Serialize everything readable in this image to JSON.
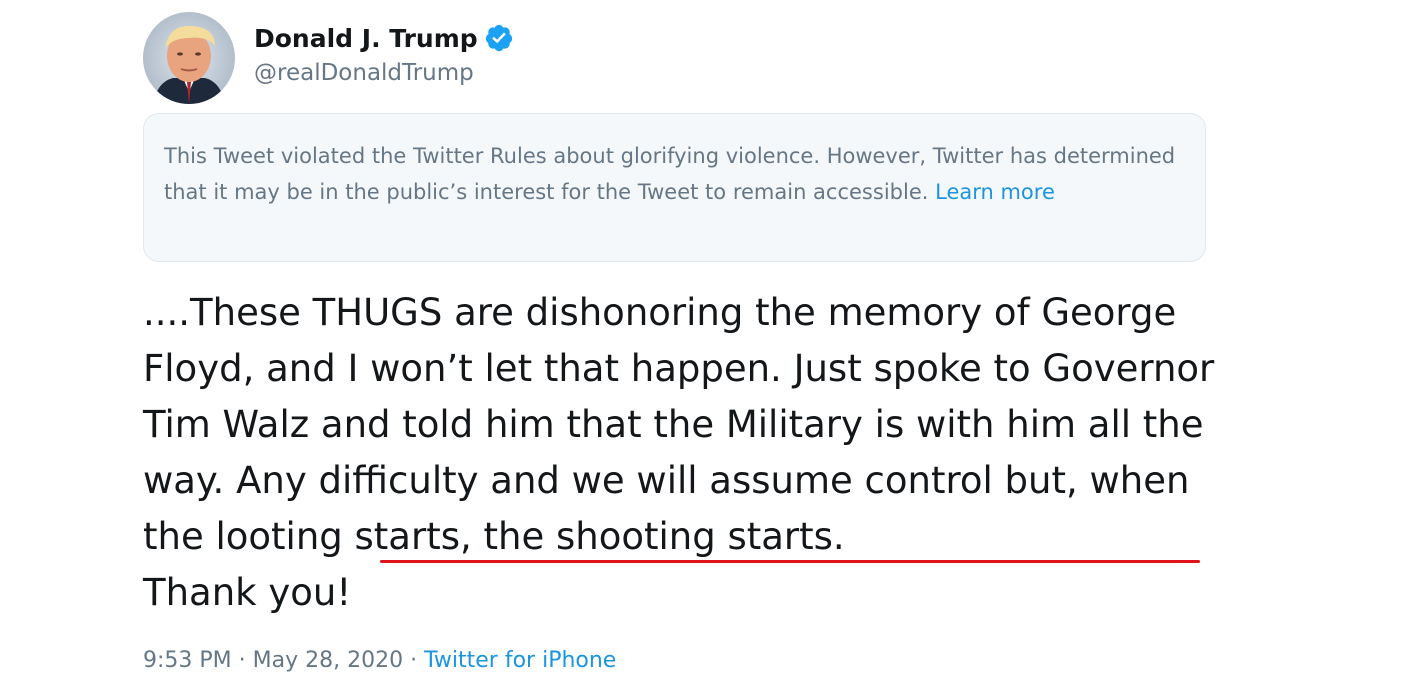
{
  "author": {
    "display_name": "Donald J. Trump",
    "handle": "@realDonaldTrump",
    "verified": true,
    "avatar_icon": "profile-photo",
    "verified_icon": "verified-badge-icon"
  },
  "notice": {
    "text": "This Tweet violated the Twitter Rules about glorifying violence. However, Twitter has determined that it may be in the public’s interest for the Tweet to remain accessible.",
    "link_label": "Learn more"
  },
  "tweet": {
    "text_before": "....These THUGS are dishonoring the memory of George Floyd, and I won’t let that happen. Just spoke to Governor Tim Walz and told him that the Military is with him all the way. Any difficulty and we will assume control but,",
    "text_highlighted": "when the looting starts, the shooting starts.",
    "text_after": "Thank you!",
    "highlight_color": "#e0121b"
  },
  "meta": {
    "time": "9:53 PM",
    "separator": "·",
    "date": "May 28, 2020",
    "source": "Twitter for iPhone"
  },
  "colors": {
    "text": "#14171a",
    "secondary": "#657786",
    "link": "#1b95e0",
    "verified": "#1da1f2",
    "notice_bg": "#f5f8fa"
  }
}
